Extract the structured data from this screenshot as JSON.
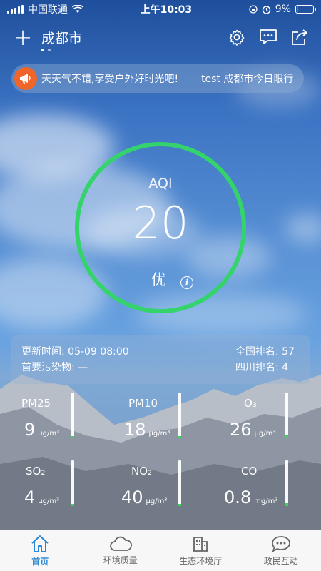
{
  "status_bar": {
    "carrier": "中国联通",
    "time": "上午10:03",
    "battery_pct": "9%",
    "battery_level": 0.09
  },
  "header": {
    "city": "成都市",
    "page_count": 2,
    "active_page": 0
  },
  "notice": {
    "text": "天天气不错,享受户外好时光吧!",
    "extra": "test  成都市今日限行"
  },
  "aqi": {
    "label": "AQI",
    "value": "20",
    "level": "优",
    "info_glyph": "i",
    "ring_color": "#34d36b"
  },
  "info": {
    "update_time": "更新时间: 05-09 08:00",
    "primary_pollutant": "首要污染物: —",
    "national_rank": "全国排名: 57",
    "sichuan_rank": "四川排名: 4"
  },
  "pollutants": [
    {
      "name": "PM25",
      "value": "9",
      "unit": "μg/m³",
      "level": 0.04
    },
    {
      "name": "PM10",
      "value": "18",
      "unit": "μg/m³",
      "level": 0.05
    },
    {
      "name": "O₃",
      "value": "26",
      "unit": "μg/m³",
      "level": 0.06
    },
    {
      "name": "SO₂",
      "value": "4",
      "unit": "μg/m³",
      "level": 0.04
    },
    {
      "name": "NO₂",
      "value": "40",
      "unit": "μg/m³",
      "level": 0.05
    },
    {
      "name": "CO",
      "value": "0.8",
      "unit": "mg/m³",
      "level": 0.06
    }
  ],
  "tabs": [
    {
      "label": "首页",
      "icon": "home-icon",
      "active": true
    },
    {
      "label": "环境质量",
      "icon": "cloud-icon",
      "active": false
    },
    {
      "label": "生态环境厅",
      "icon": "building-icon",
      "active": false
    },
    {
      "label": "政民互动",
      "icon": "chat-bubble-icon",
      "active": false
    }
  ],
  "colors": {
    "accent": "#2b86d3",
    "aqi_good": "#34d36b",
    "notice_badge": "#f0662a"
  }
}
